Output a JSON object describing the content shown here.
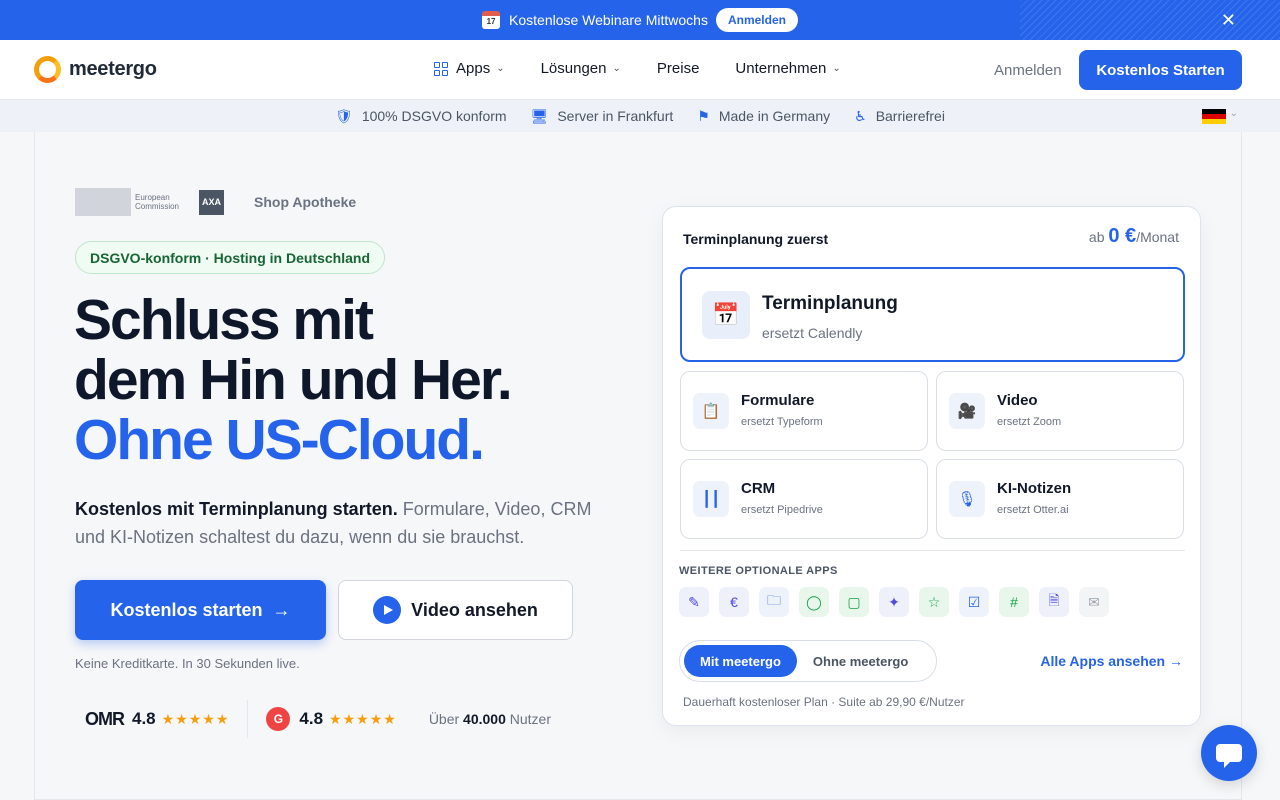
{
  "banner": {
    "calendar_day": "17",
    "text": "Kostenlose Webinare Mittwochs",
    "button": "Anmelden",
    "close": "✕"
  },
  "nav": {
    "logo": "meetergo",
    "items": [
      {
        "label": "Apps",
        "chevron": "⌄"
      },
      {
        "label": "Lösungen",
        "chevron": "⌄"
      },
      {
        "label": "Preise"
      },
      {
        "label": "Unternehmen",
        "chevron": "⌄"
      }
    ],
    "signin": "Anmelden",
    "cta": "Kostenlos Starten"
  },
  "trust_bar": [
    {
      "icon": "🛡",
      "label": "100% DSGVO konform"
    },
    {
      "icon": "🖥",
      "label": "Server in Frankfurt"
    },
    {
      "icon": "⚑",
      "label": "Made in Germany"
    },
    {
      "icon": "♿",
      "label": "Barrierefrei"
    }
  ],
  "hero": {
    "partner_logos": {
      "eu_line1": "European",
      "eu_line2": "Commission",
      "axa": "AXA",
      "shop": "Shop Apotheke"
    },
    "badge": "DSGVO-konform · Hosting in Deutschland",
    "headline_1": "Schluss mit",
    "headline_2": "dem Hin und Her.",
    "headline_3": "Ohne US-Cloud.",
    "sub_bold": "Kostenlos mit Terminplanung starten.",
    "sub_rest": " Formulare, Video, CRM und KI-Notizen schaltest du dazu, wenn du sie brauchst.",
    "primary_button": "Kostenlos starten",
    "primary_arrow": "→",
    "secondary_button": "Video ansehen",
    "note": "Keine Kreditkarte. In 30 Sekunden live."
  },
  "ratings": {
    "omr_logo": "OMR",
    "omr_score": "4.8",
    "g2_logo": "G",
    "g2_score": "4.8",
    "stars": "★★★★★",
    "users_prefix": "Über ",
    "users_count": "40.000",
    "users_suffix": " Nutzer"
  },
  "card": {
    "title": "Terminplanung zuerst",
    "price_prefix": "ab ",
    "price_value": "0 €",
    "price_suffix": "/Monat",
    "main_app": {
      "icon": "📅",
      "title": "Terminplanung",
      "subtitle": "ersetzt Calendly"
    },
    "apps": [
      {
        "icon": "📋",
        "title": "Formulare",
        "subtitle": "ersetzt Typeform"
      },
      {
        "icon": "🎥",
        "title": "Video",
        "subtitle": "ersetzt Zoom"
      },
      {
        "icon": "┃┃",
        "title": "CRM",
        "subtitle": "ersetzt Pipedrive"
      },
      {
        "icon": "🎙",
        "title": "KI-Notizen",
        "subtitle": "ersetzt Otter.ai"
      }
    ],
    "more_title": "WEITERE OPTIONALE APPS",
    "mini_apps": [
      {
        "icon": "✎",
        "bg": "#eef0fa",
        "color": "#4f46e5"
      },
      {
        "icon": "€",
        "bg": "#eef0fa",
        "color": "#4f46e5"
      },
      {
        "icon": "🗀",
        "bg": "#eef2fb",
        "color": "#2563eb"
      },
      {
        "icon": "◯",
        "bg": "#e8f6ec",
        "color": "#16a34a"
      },
      {
        "icon": "▢",
        "bg": "#e8f6ec",
        "color": "#16a34a"
      },
      {
        "icon": "✦",
        "bg": "#eef0fa",
        "color": "#4f46e5"
      },
      {
        "icon": "☆",
        "bg": "#e8f6ec",
        "color": "#16a34a"
      },
      {
        "icon": "☑",
        "bg": "#eef2fb",
        "color": "#2563eb"
      },
      {
        "icon": "#",
        "bg": "#e8f6ec",
        "color": "#16a34a"
      },
      {
        "icon": "🗎",
        "bg": "#eef0fa",
        "color": "#4f46e5"
      },
      {
        "icon": "✉",
        "bg": "#f3f4f6",
        "color": "#9ca3af"
      }
    ],
    "toggle_on": "Mit meetergo",
    "toggle_off": "Ohne meetergo",
    "all_apps": "Alle Apps ansehen →",
    "plan_note": "Dauerhaft kostenloser Plan · Suite ab 29,90 €/Nutzer"
  },
  "colors": {
    "accent": "#2563eb",
    "badge_green": "#166534",
    "star": "#f59e0b"
  }
}
